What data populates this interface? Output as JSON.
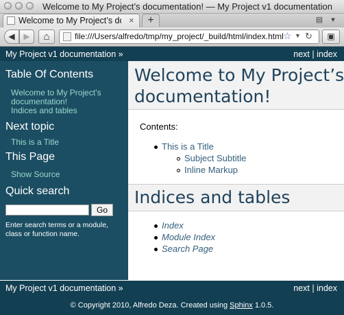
{
  "window": {
    "title": "Welcome to My Project’s documentation! — My Project v1 documentation"
  },
  "tab": {
    "label": "Welcome to My Project’s documen...",
    "close_glyph": "×",
    "new_tab_glyph": "+"
  },
  "navbar": {
    "back_glyph": "◀",
    "forward_glyph": "▶",
    "home_glyph": "⌂",
    "url": "file:///Users/alfredo/tmp/my_project/_build/html/index.html",
    "bookmark_glyph": "☆",
    "dropdown_glyph": "▼",
    "reload_glyph": "↻",
    "addon_glyph": "▣"
  },
  "relbar": {
    "brand": "My Project v1 documentation",
    "brand_suffix": " »",
    "next": "next",
    "separator": " | ",
    "index": "index"
  },
  "sidebar": {
    "toc_heading": "Table Of Contents",
    "toc_links": [
      "Welcome to My Project’s",
      "documentation!",
      "Indices and tables"
    ],
    "next_heading": "Next topic",
    "next_link": "This is a Title",
    "page_heading": "This Page",
    "show_source": "Show Source",
    "search_heading": "Quick search",
    "search_value": "",
    "go_label": "Go",
    "help_text": "Enter search terms or a module, class or function name."
  },
  "main": {
    "title_line1": "Welcome to My Project’s",
    "title_line2": "documentation!",
    "contents_label": "Contents:",
    "toc": [
      "This is a Title",
      "Subject Subtitle",
      "Inline Markup"
    ],
    "indices_heading": "Indices and tables",
    "indices": [
      "Index",
      "Module Index",
      "Search Page"
    ]
  },
  "footer": {
    "copyright": "© Copyright 2010, Alfredo Deza. Created using ",
    "sphinx": "Sphinx",
    "version": " 1.0.5."
  },
  "colors": {
    "header_bg": "#133f52",
    "sidebar_bg": "#1c4e63",
    "sidebar_link": "#98dbcc",
    "heading_text": "#20435c",
    "content_link": "#355f7c"
  }
}
